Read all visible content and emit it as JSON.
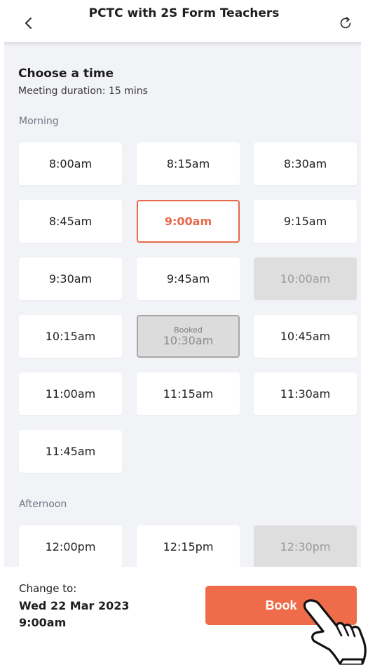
{
  "header": {
    "title": "PCTC with 2S Form Teachers",
    "back_icon": "chevron-left-icon",
    "refresh_icon": "refresh-icon"
  },
  "main": {
    "title": "Choose a time",
    "duration": "Meeting duration: 15 mins",
    "morning_label": "Morning",
    "afternoon_label": "Afternoon",
    "morning_slots": [
      {
        "time": "8:00am",
        "state": "available"
      },
      {
        "time": "8:15am",
        "state": "available"
      },
      {
        "time": "8:30am",
        "state": "available"
      },
      {
        "time": "8:45am",
        "state": "available"
      },
      {
        "time": "9:00am",
        "state": "selected"
      },
      {
        "time": "9:15am",
        "state": "available"
      },
      {
        "time": "9:30am",
        "state": "available"
      },
      {
        "time": "9:45am",
        "state": "available"
      },
      {
        "time": "10:00am",
        "state": "disabled"
      },
      {
        "time": "10:15am",
        "state": "available"
      },
      {
        "time": "10:30am",
        "state": "booked",
        "tag": "Booked"
      },
      {
        "time": "10:45am",
        "state": "available"
      },
      {
        "time": "11:00am",
        "state": "available"
      },
      {
        "time": "11:15am",
        "state": "available"
      },
      {
        "time": "11:30am",
        "state": "available"
      },
      {
        "time": "11:45am",
        "state": "available"
      }
    ],
    "afternoon_slots": [
      {
        "time": "12:00pm",
        "state": "available"
      },
      {
        "time": "12:15pm",
        "state": "available"
      },
      {
        "time": "12:30pm",
        "state": "disabled"
      }
    ]
  },
  "footer": {
    "change_label": "Change to:",
    "date": "Wed 22 Mar 2023",
    "time": "9:00am",
    "book_label": "Book"
  },
  "colors": {
    "accent": "#ef6c4a",
    "selected": "#e8694a",
    "background": "#f2f3f7",
    "disabled": "#dedede"
  }
}
